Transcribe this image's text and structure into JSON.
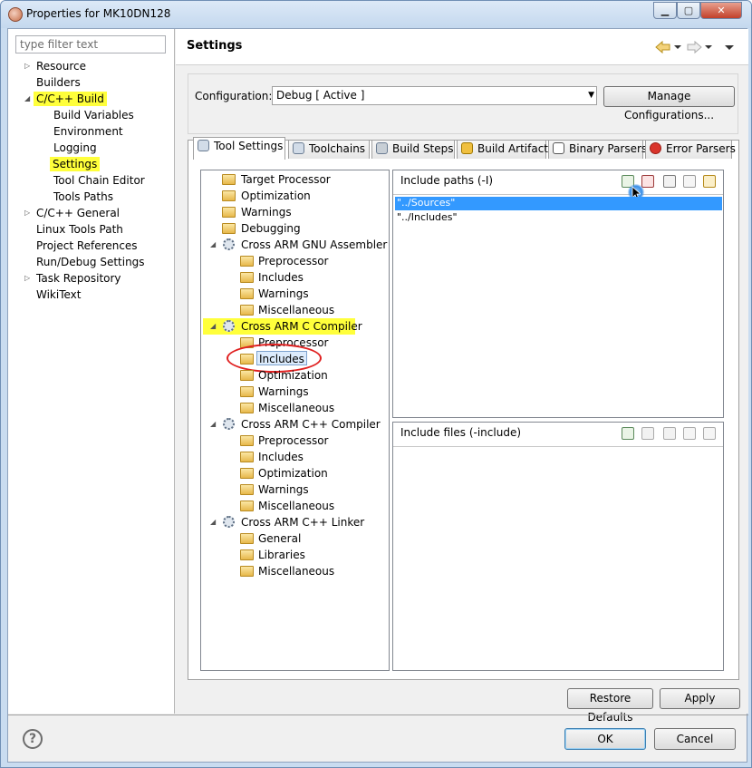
{
  "window": {
    "title": "Properties for MK10DN128",
    "min": "▁",
    "max": "▢",
    "close": "✕"
  },
  "left": {
    "filter_placeholder": "type filter text",
    "items": [
      {
        "label": "Resource"
      },
      {
        "label": "Builders"
      },
      {
        "label": "C/C++ Build"
      },
      {
        "label": "Build Variables"
      },
      {
        "label": "Environment"
      },
      {
        "label": "Logging"
      },
      {
        "label": "Settings"
      },
      {
        "label": "Tool Chain Editor"
      },
      {
        "label": "Tools Paths"
      },
      {
        "label": "C/C++ General"
      },
      {
        "label": "Linux Tools Path"
      },
      {
        "label": "Project References"
      },
      {
        "label": "Run/Debug Settings"
      },
      {
        "label": "Task Repository"
      },
      {
        "label": "WikiText"
      }
    ]
  },
  "header": {
    "title": "Settings"
  },
  "config": {
    "label": "Configuration:",
    "value": "Debug  [ Active ]",
    "manage_label": "Manage Configurations..."
  },
  "tabs": [
    {
      "label": "Tool Settings"
    },
    {
      "label": "Toolchains"
    },
    {
      "label": "Build Steps"
    },
    {
      "label": "Build Artifact"
    },
    {
      "label": "Binary Parsers"
    },
    {
      "label": "Error Parsers"
    }
  ],
  "tool_tree": [
    {
      "label": "Target Processor"
    },
    {
      "label": "Optimization"
    },
    {
      "label": "Warnings"
    },
    {
      "label": "Debugging"
    },
    {
      "label": "Cross ARM GNU Assembler"
    },
    {
      "label": "Preprocessor"
    },
    {
      "label": "Includes"
    },
    {
      "label": "Warnings"
    },
    {
      "label": "Miscellaneous"
    },
    {
      "label": "Cross ARM C Compiler"
    },
    {
      "label": "Preprocessor"
    },
    {
      "label": "Includes"
    },
    {
      "label": "Optimization"
    },
    {
      "label": "Warnings"
    },
    {
      "label": "Miscellaneous"
    },
    {
      "label": "Cross ARM C++ Compiler"
    },
    {
      "label": "Preprocessor"
    },
    {
      "label": "Includes"
    },
    {
      "label": "Optimization"
    },
    {
      "label": "Warnings"
    },
    {
      "label": "Miscellaneous"
    },
    {
      "label": "Cross ARM C++ Linker"
    },
    {
      "label": "General"
    },
    {
      "label": "Libraries"
    },
    {
      "label": "Miscellaneous"
    }
  ],
  "include_paths": {
    "title": "Include paths (-I)",
    "items": [
      "\"../Sources\"",
      "\"../Includes\""
    ]
  },
  "include_files": {
    "title": "Include files (-include)"
  },
  "buttons": {
    "restore": "Restore Defaults",
    "apply": "Apply",
    "ok": "OK",
    "cancel": "Cancel",
    "help": "?"
  },
  "colors": {
    "highlight": "#ffff3b",
    "selection": "#3399ff",
    "annotation": "#e02020"
  }
}
